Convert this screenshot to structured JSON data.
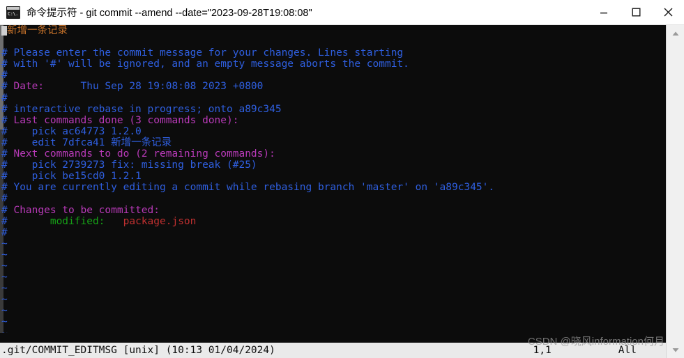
{
  "window": {
    "title": "命令提示符 - git  commit --amend --date=\"2023-09-28T19:08:08\"",
    "icon_text": "C:\\.",
    "controls": {
      "minimize": "minimize",
      "maximize": "maximize",
      "close": "close"
    }
  },
  "terminal": {
    "background": "#0c0c0c",
    "colors": {
      "blue": "#2f5fe0",
      "magenta": "#b83ab8",
      "orange": "#c8732a",
      "green": "#16a016",
      "red": "#c03030"
    },
    "lines": [
      {
        "id": "commit-subject",
        "segments": [
          {
            "text": " ",
            "color": "cursor"
          },
          {
            "text": "新增一条记录",
            "color": "orange"
          }
        ]
      },
      {
        "id": "blank-1",
        "segments": []
      },
      {
        "id": "help-1",
        "segments": [
          {
            "text": "# Please enter the commit message for your changes. Lines starting",
            "color": "blue"
          }
        ]
      },
      {
        "id": "help-2",
        "segments": [
          {
            "text": "# with '#' will be ignored, and an empty message aborts the commit.",
            "color": "blue"
          }
        ]
      },
      {
        "id": "hash-1",
        "segments": [
          {
            "text": "#",
            "color": "blue"
          }
        ]
      },
      {
        "id": "date",
        "segments": [
          {
            "text": "# ",
            "color": "blue"
          },
          {
            "text": "Date:",
            "color": "magenta"
          },
          {
            "text": "      Thu Sep 28 19:08:08 2023 +0800",
            "color": "blue"
          }
        ]
      },
      {
        "id": "hash-2",
        "segments": [
          {
            "text": "#",
            "color": "blue"
          }
        ]
      },
      {
        "id": "rebase-progress",
        "segments": [
          {
            "text": "# interactive rebase in progress; onto a89c345",
            "color": "blue"
          }
        ]
      },
      {
        "id": "last-commands-header",
        "segments": [
          {
            "text": "# ",
            "color": "blue"
          },
          {
            "text": "Last commands done (3 commands done):",
            "color": "magenta"
          }
        ]
      },
      {
        "id": "done-1",
        "segments": [
          {
            "text": "#    pick ac64773 1.2.0",
            "color": "blue"
          }
        ]
      },
      {
        "id": "done-2",
        "segments": [
          {
            "text": "#    edit 7dfca41 新增一条记录",
            "color": "blue"
          }
        ]
      },
      {
        "id": "next-commands-header",
        "segments": [
          {
            "text": "# ",
            "color": "blue"
          },
          {
            "text": "Next commands to do (2 remaining commands):",
            "color": "magenta"
          }
        ]
      },
      {
        "id": "next-1",
        "segments": [
          {
            "text": "#    pick 2739273 fix: missing break (#25)",
            "color": "blue"
          }
        ]
      },
      {
        "id": "next-2",
        "segments": [
          {
            "text": "#    pick be15cd0 1.2.1",
            "color": "blue"
          }
        ]
      },
      {
        "id": "currently-editing",
        "segments": [
          {
            "text": "# You are currently editing a commit while rebasing branch 'master' on 'a89c345'.",
            "color": "blue"
          }
        ]
      },
      {
        "id": "hash-3",
        "segments": [
          {
            "text": "#",
            "color": "blue"
          }
        ]
      },
      {
        "id": "changes-header",
        "segments": [
          {
            "text": "# ",
            "color": "blue"
          },
          {
            "text": "Changes to be committed:",
            "color": "magenta"
          }
        ]
      },
      {
        "id": "changes-1",
        "segments": [
          {
            "text": "#       ",
            "color": "blue"
          },
          {
            "text": "modified:",
            "color": "green"
          },
          {
            "text": "   ",
            "color": "blue"
          },
          {
            "text": "package.json",
            "color": "red"
          }
        ]
      },
      {
        "id": "hash-4",
        "segments": [
          {
            "text": "#",
            "color": "blue"
          }
        ]
      },
      {
        "id": "tilde-1",
        "segments": [
          {
            "text": "~",
            "color": "blue"
          }
        ]
      },
      {
        "id": "tilde-2",
        "segments": [
          {
            "text": "~",
            "color": "blue"
          }
        ]
      },
      {
        "id": "tilde-3",
        "segments": [
          {
            "text": "~",
            "color": "blue"
          }
        ]
      },
      {
        "id": "tilde-4",
        "segments": [
          {
            "text": "~",
            "color": "blue"
          }
        ]
      },
      {
        "id": "tilde-5",
        "segments": [
          {
            "text": "~",
            "color": "blue"
          }
        ]
      },
      {
        "id": "tilde-6",
        "segments": [
          {
            "text": "~",
            "color": "blue"
          }
        ]
      },
      {
        "id": "tilde-7",
        "segments": [
          {
            "text": "~",
            "color": "blue"
          }
        ]
      },
      {
        "id": "tilde-8",
        "segments": [
          {
            "text": "~",
            "color": "blue"
          }
        ]
      },
      {
        "id": "tilde-9",
        "segments": [
          {
            "text": "~",
            "color": "blue"
          }
        ]
      }
    ]
  },
  "statusbar": {
    "left": ".git/COMMIT_EDITMSG [unix] (10:13 01/04/2024)",
    "right": "1,1           All"
  },
  "scrollbar": {
    "up_arrow": "▲",
    "down_arrow": "▼"
  },
  "watermark": {
    "text": "CSDN @晓风information何月"
  }
}
